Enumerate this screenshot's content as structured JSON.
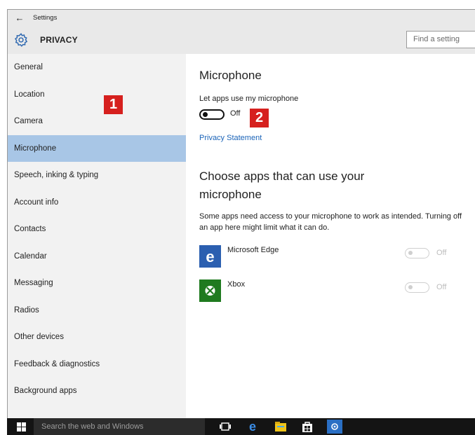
{
  "window": {
    "title": "Settings",
    "back_icon": "back-arrow-icon"
  },
  "header": {
    "icon": "gear-icon",
    "title": "PRIVACY",
    "search_placeholder": "Find a setting"
  },
  "sidebar": {
    "selected_index": 3,
    "items": [
      {
        "label": "General"
      },
      {
        "label": "Location"
      },
      {
        "label": "Camera"
      },
      {
        "label": "Microphone"
      },
      {
        "label": "Speech, inking & typing"
      },
      {
        "label": "Account info"
      },
      {
        "label": "Contacts"
      },
      {
        "label": "Calendar"
      },
      {
        "label": "Messaging"
      },
      {
        "label": "Radios"
      },
      {
        "label": "Other devices"
      },
      {
        "label": "Feedback & diagnostics"
      },
      {
        "label": "Background apps"
      }
    ]
  },
  "callouts": [
    "1",
    "2"
  ],
  "main": {
    "heading": "Microphone",
    "toggle_label": "Let apps use my microphone",
    "toggle_state": "Off",
    "toggle_on": false,
    "privacy_link": "Privacy Statement",
    "subheading": "Choose apps that can use your microphone",
    "description": "Some apps need access to your microphone to work as intended. Turning off an app here might limit what it can do.",
    "apps": [
      {
        "name": "Microsoft Edge",
        "state": "Off",
        "enabled": false,
        "icon": "edge-icon",
        "color": "#2b5fb0"
      },
      {
        "name": "Xbox",
        "state": "Off",
        "enabled": false,
        "icon": "xbox-icon",
        "color": "#1f7a1f"
      }
    ]
  },
  "taskbar": {
    "search_placeholder": "Search the web and Windows",
    "icons": [
      "windows-start-icon",
      "task-view-icon",
      "edge-icon",
      "file-explorer-icon",
      "store-icon",
      "settings-icon"
    ]
  },
  "colors": {
    "selected_nav": "#a8c6e6",
    "callout": "#d6201e",
    "link": "#1a63b8",
    "taskbar": "#141414"
  }
}
